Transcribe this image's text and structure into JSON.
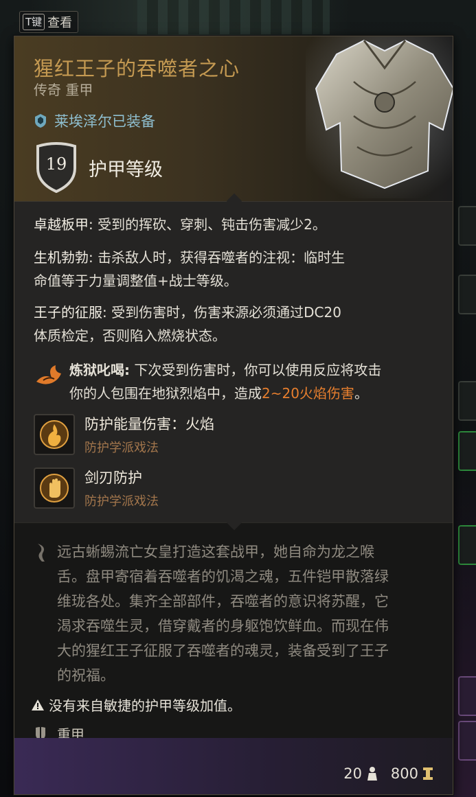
{
  "hotkey": {
    "key": "T键",
    "label": "查看"
  },
  "item": {
    "name": "猩红王子的吞噬者之心",
    "rarity_type": "传奇 重甲",
    "equipped_by": "莱埃泽尔已装备",
    "armor_class_value": "19",
    "armor_class_label": "护甲等级"
  },
  "properties": {
    "p1_name": "卓越板甲:",
    "p1_text": " 受到的挥砍、穿刺、钝击伤害减少2。",
    "p2_name": "生机勃勃:",
    "p2_text_a": " 击杀敌人时，获得吞噬者的注视：临时生",
    "p2_text_b": "命值等于力量调整值+战士等级。",
    "p3_name": "王子的征服:",
    "p3_text_a": " 受到伤害时，伤害来源必须通过DC20",
    "p3_text_b": "体质检定，否则陷入燃烧状态。",
    "reaction_name": "炼狱叱喝:",
    "reaction_text_a": " 下次受到伤害时，你可以使用反应将攻击",
    "reaction_text_b": "你的人包围在地狱烈焰中，造成",
    "reaction_damage": "2~20火焰伤害",
    "reaction_end": "。"
  },
  "spells": [
    {
      "name": "防护能量伤害：火焰",
      "school": "防护学派戏法",
      "icon": "fire-ward-icon"
    },
    {
      "name": "剑刃防护",
      "school": "防护学派戏法",
      "icon": "hand-ward-icon"
    }
  ],
  "lore": {
    "lines": [
      "远古蜥蜴流亡女皇打造这套战甲，她自命为龙之喉",
      "舌。盘甲寄宿着吞噬者的饥渴之魂，五件铠甲散落绿",
      "维珑各处。集齐全部部件，吞噬者的意识将苏醒，它",
      "渴求吞噬生灵，借穿戴者的身躯饱饮鲜血。而现在伟",
      "大的猩红王子征服了吞噬者的魂灵，装备受到了王子",
      "的祝福。"
    ],
    "warning": "没有来自敏捷的护甲等级加值。",
    "armor_type": "重甲"
  },
  "footer": {
    "weight": "20",
    "value": "800"
  },
  "colors": {
    "title": "#c59a52",
    "damage": "#e87f2e",
    "school": "#a3764c",
    "equipped": "#8fbfd0"
  }
}
